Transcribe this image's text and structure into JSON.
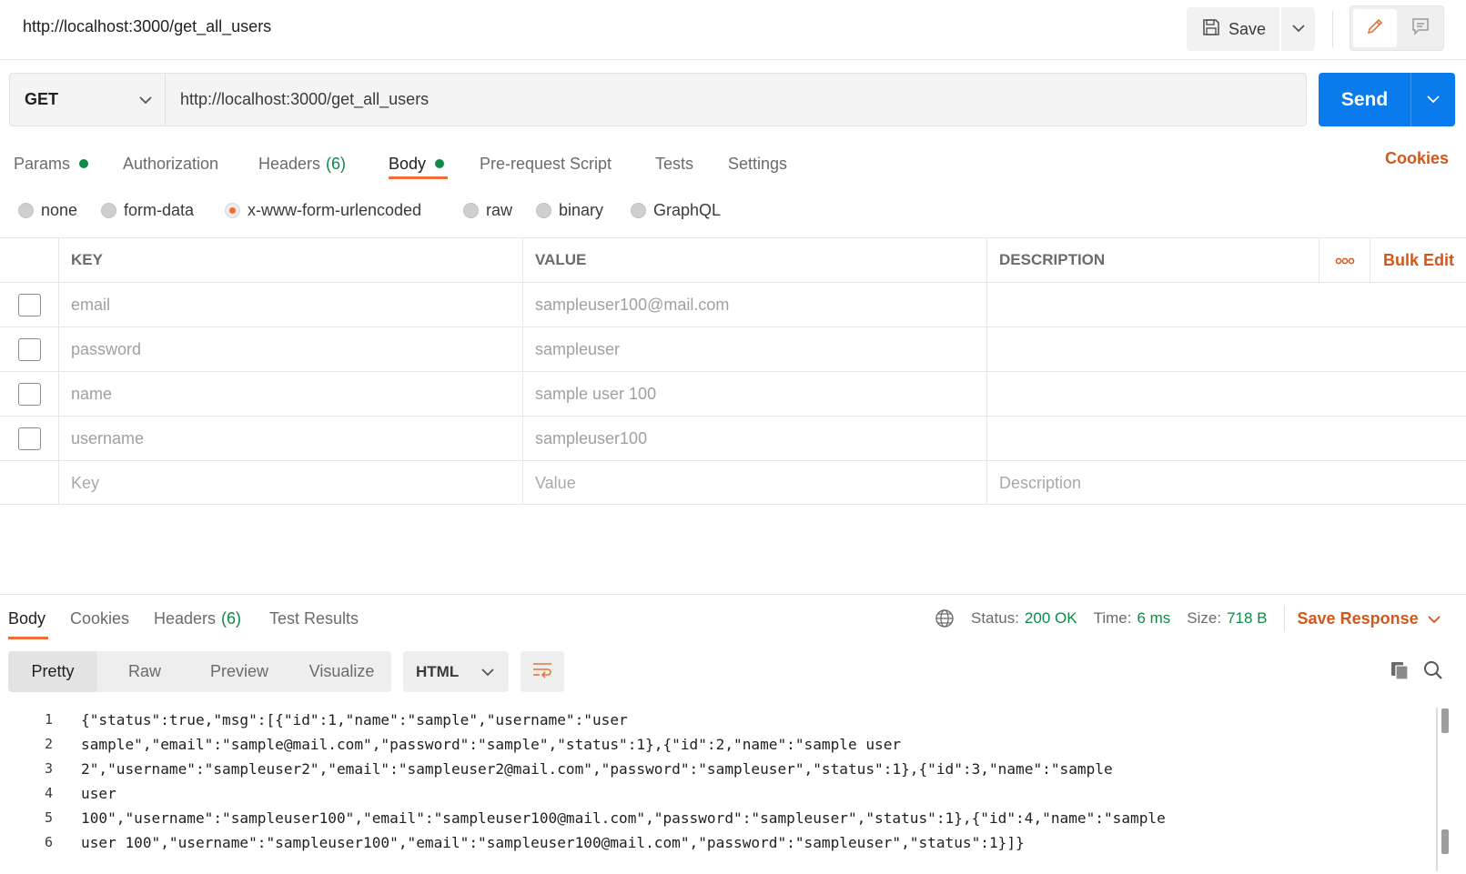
{
  "header": {
    "title": "http://localhost:3000/get_all_users",
    "save_label": "Save"
  },
  "request": {
    "method": "GET",
    "url": "http://localhost:3000/get_all_users",
    "send_label": "Send"
  },
  "request_tabs": [
    {
      "label": "Params",
      "dot": true
    },
    {
      "label": "Authorization"
    },
    {
      "label": "Headers",
      "count": "(6)"
    },
    {
      "label": "Body",
      "dot": true,
      "active": true
    },
    {
      "label": "Pre-request Script"
    },
    {
      "label": "Tests"
    },
    {
      "label": "Settings"
    }
  ],
  "cookies_label": "Cookies",
  "body_types": [
    {
      "label": "none"
    },
    {
      "label": "form-data"
    },
    {
      "label": "x-www-form-urlencoded",
      "selected": true
    },
    {
      "label": "raw"
    },
    {
      "label": "binary"
    },
    {
      "label": "GraphQL"
    }
  ],
  "kv_table": {
    "headers": {
      "key": "KEY",
      "value": "VALUE",
      "description": "DESCRIPTION",
      "bulk_edit": "Bulk Edit"
    },
    "rows": [
      {
        "key": "email",
        "value": "sampleuser100@mail.com",
        "checked": false
      },
      {
        "key": "password",
        "value": "sampleuser",
        "checked": false
      },
      {
        "key": "name",
        "value": "sample user 100",
        "checked": false
      },
      {
        "key": "username",
        "value": "sampleuser100",
        "checked": false
      }
    ],
    "placeholders": {
      "key": "Key",
      "value": "Value",
      "description": "Description"
    }
  },
  "response_tabs": [
    {
      "label": "Body",
      "active": true
    },
    {
      "label": "Cookies"
    },
    {
      "label": "Headers",
      "count": "(6)"
    },
    {
      "label": "Test Results"
    }
  ],
  "status": {
    "status_label": "Status:",
    "status_value": "200 OK",
    "time_label": "Time:",
    "time_value": "6 ms",
    "size_label": "Size:",
    "size_value": "718 B",
    "save_response": "Save Response"
  },
  "view_modes": [
    "Pretty",
    "Raw",
    "Preview",
    "Visualize"
  ],
  "active_view": "Pretty",
  "language": "HTML",
  "code_lines": [
    "{\"status\":true,\"msg\":[{\"id\":1,\"name\":\"sample\",\"username\":\"user",
    "sample\",\"email\":\"sample@mail.com\",\"password\":\"sample\",\"status\":1},{\"id\":2,\"name\":\"sample user",
    "2\",\"username\":\"sampleuser2\",\"email\":\"sampleuser2@mail.com\",\"password\":\"sampleuser\",\"status\":1},{\"id\":3,\"name\":\"sample",
    "user",
    "100\",\"username\":\"sampleuser100\",\"email\":\"sampleuser100@mail.com\",\"password\":\"sampleuser\",\"status\":1},{\"id\":4,\"name\":\"sample",
    "user 100\",\"username\":\"sampleuser100\",\"email\":\"sampleuser100@mail.com\",\"password\":\"sampleuser\",\"status\":1}]}"
  ],
  "line_numbers": [
    "1",
    "2",
    "3",
    "4",
    "5",
    "6"
  ],
  "colors": {
    "accent": "#f26b3a",
    "link": "#d0581c",
    "send": "#097bed",
    "success": "#0c8a46"
  }
}
